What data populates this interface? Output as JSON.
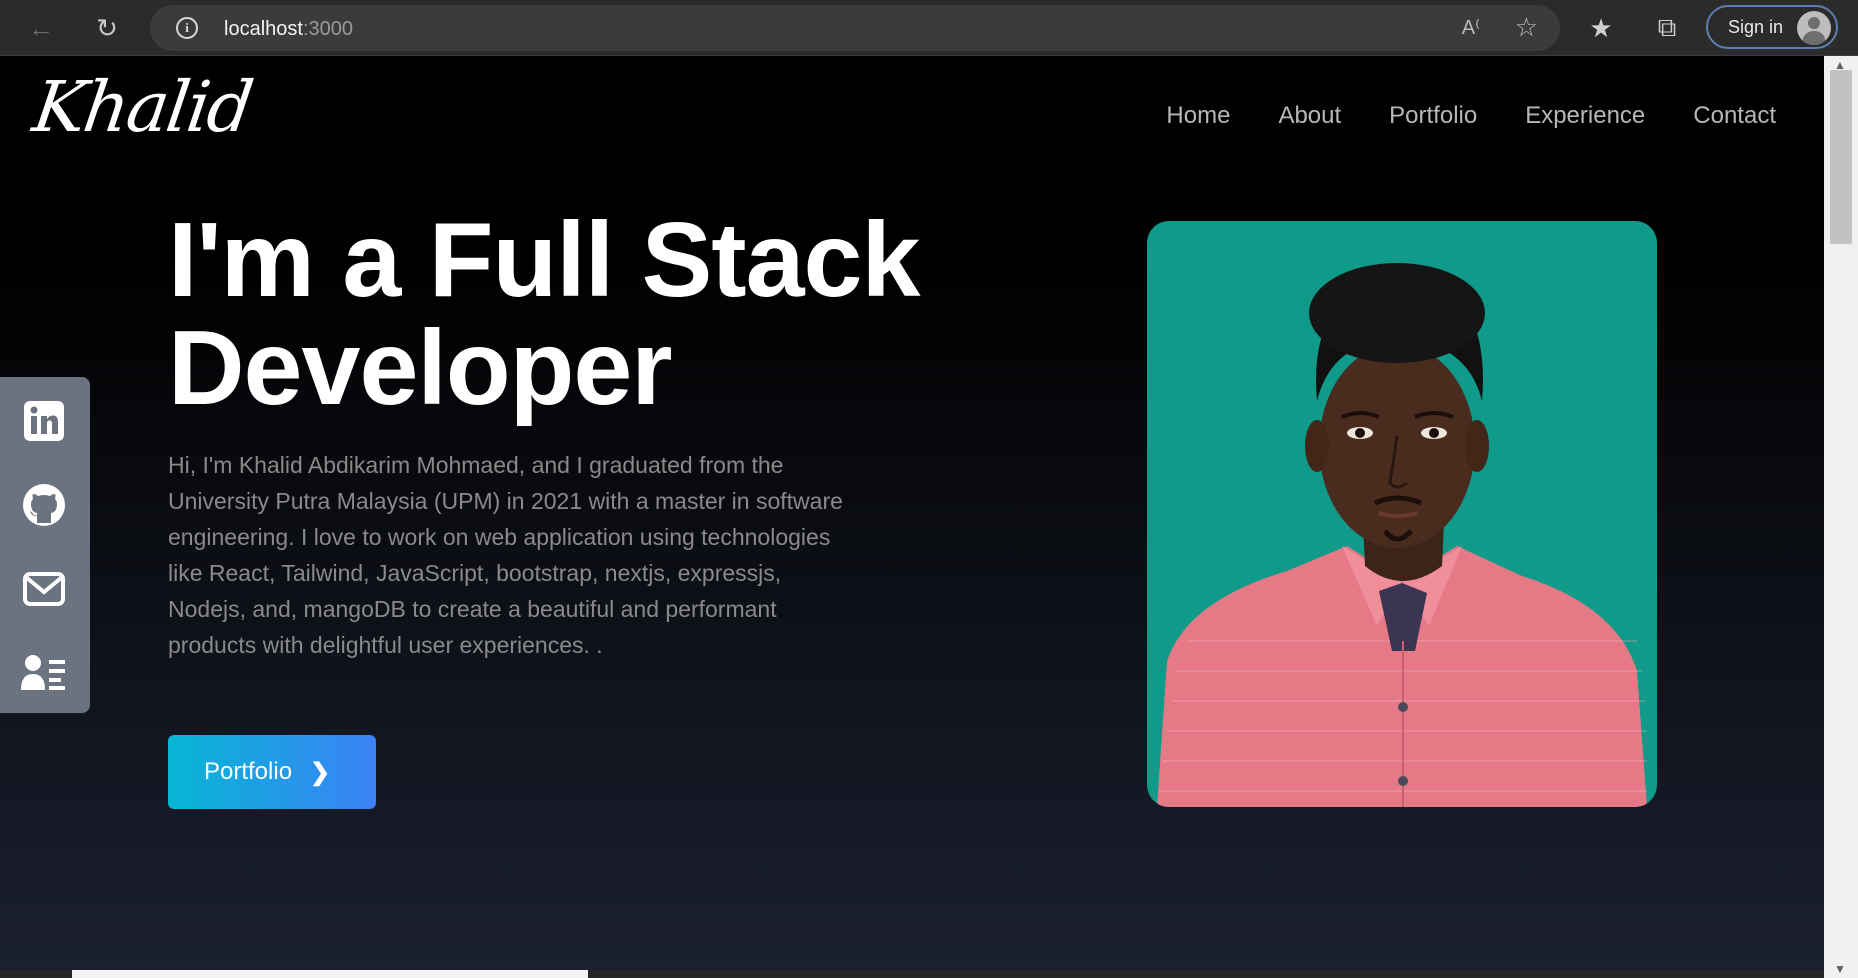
{
  "browser": {
    "url_host": "localhost",
    "url_port": ":3000",
    "signin_label": "Sign in"
  },
  "site": {
    "logo": "Khalid",
    "nav": [
      "Home",
      "About",
      "Portfolio",
      "Experience",
      "Contact"
    ]
  },
  "hero": {
    "title_line1": "I'm a Full Stack",
    "title_line2": "Developer",
    "description": "Hi, I'm Khalid Abdikarim Mohmaed, and I graduated from the University Putra Malaysia (UPM) in 2021 with a master in software engineering. I love to work on web application using technologies like React, Tailwind, JavaScript, bootstrap, nextjs, expressjs, Nodejs, and, mangoDB to create a beautiful and performant products with delightful user experiences. .",
    "cta_label": "Portfolio"
  },
  "social": [
    "linkedin-icon",
    "github-icon",
    "mail-icon",
    "resume-icon"
  ],
  "colors": {
    "accent_start": "#06b6d4",
    "accent_end": "#3b82f6",
    "photo_bg": "#0f9a8a",
    "social_bar": "#6b7280"
  }
}
